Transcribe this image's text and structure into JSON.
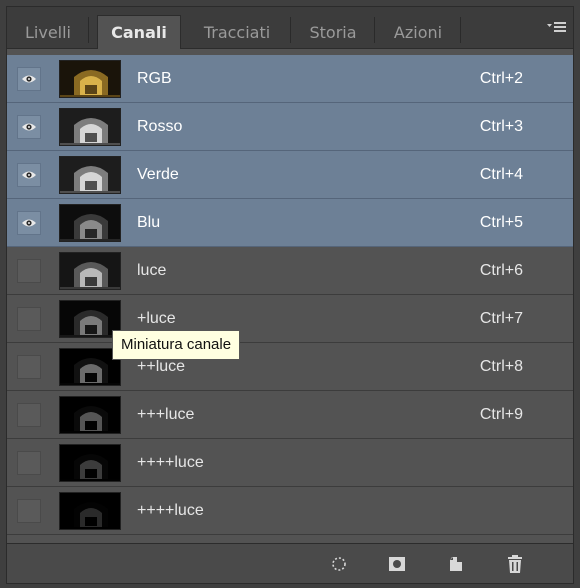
{
  "tabs": [
    {
      "label": "Livelli",
      "active": false
    },
    {
      "label": "Canali",
      "active": true
    },
    {
      "label": "Tracciati",
      "active": false
    },
    {
      "label": "Storia",
      "active": false
    },
    {
      "label": "Azioni",
      "active": false
    }
  ],
  "menu_icon": "panel-menu-icon",
  "channels": [
    {
      "name": "RGB",
      "shortcut": "Ctrl+2",
      "selected": true,
      "visible": true,
      "thumb": "rgb"
    },
    {
      "name": "Rosso",
      "shortcut": "Ctrl+3",
      "selected": true,
      "visible": true,
      "thumb": "gray-light"
    },
    {
      "name": "Verde",
      "shortcut": "Ctrl+4",
      "selected": true,
      "visible": true,
      "thumb": "gray-light"
    },
    {
      "name": "Blu",
      "shortcut": "Ctrl+5",
      "selected": true,
      "visible": true,
      "thumb": "gray-dark"
    },
    {
      "name": "luce",
      "shortcut": "Ctrl+6",
      "selected": false,
      "visible": false,
      "thumb": "gray-mid"
    },
    {
      "name": "+luce",
      "shortcut": "Ctrl+7",
      "selected": false,
      "visible": false,
      "thumb": "gray-darker"
    },
    {
      "name": "++luce",
      "shortcut": "Ctrl+8",
      "selected": false,
      "visible": false,
      "thumb": "black-1"
    },
    {
      "name": "+++luce",
      "shortcut": "Ctrl+9",
      "selected": false,
      "visible": false,
      "thumb": "black-2"
    },
    {
      "name": "++++luce",
      "shortcut": "",
      "selected": false,
      "visible": false,
      "thumb": "black-3"
    },
    {
      "name": "++++luce",
      "shortcut": "",
      "selected": false,
      "visible": false,
      "thumb": "black-4"
    }
  ],
  "tooltip": "Miniatura canale",
  "bottom_icons": [
    "load-selection-icon",
    "save-selection-icon",
    "new-channel-icon",
    "delete-channel-icon"
  ],
  "colors": {
    "panel_bg": "#535353",
    "selected_row": "#6d8096",
    "tooltip_bg": "#ffffe1"
  }
}
